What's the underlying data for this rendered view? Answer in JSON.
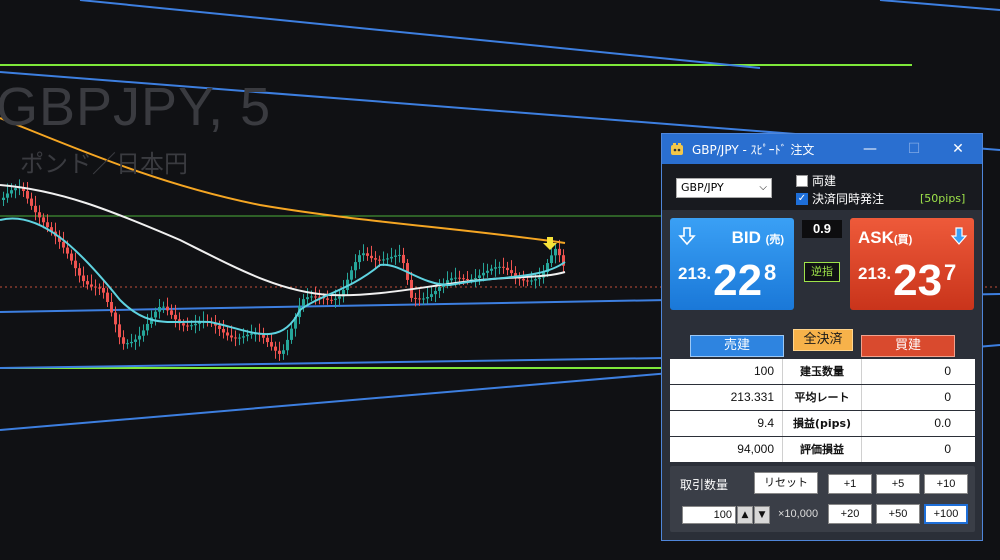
{
  "chart": {
    "symbol": "GBPJPY, 5",
    "name": "ポンド／日本円",
    "colors": {
      "background": "#101114",
      "bull": "#26a69a",
      "bear": "#ef5350",
      "ma_fast": "#5fd3e0",
      "ma_mid": "#f0f0f0",
      "ma_slow": "#f5a623",
      "trendline": "#3d7fe0",
      "level": "#7ee83a"
    }
  },
  "window": {
    "title": "GBP/JPY - ｽﾋﾟｰﾄﾞ 注文",
    "minimize": "—",
    "maximize": "☐",
    "close": "✕"
  },
  "order": {
    "pair": "GBP/JPY",
    "hedge_label": "両建",
    "hedge_checked": false,
    "oco_label": "決済同時発注",
    "oco_checked": true,
    "pips": "[50pips]",
    "bid": {
      "label": "BID",
      "sub": "(売)",
      "prefix": "213.",
      "big": "22",
      "pip": "8"
    },
    "ask": {
      "label": "ASK",
      "sub": "(買)",
      "prefix": "213.",
      "big": "23",
      "pip": "7"
    },
    "spread": "0.9",
    "stop_label": "逆指",
    "sell_tab": "売建",
    "buy_tab": "買建",
    "close_all": "全決済"
  },
  "positions": [
    {
      "sell": "100",
      "label": "建玉数量",
      "buy": "0"
    },
    {
      "sell": "213.331",
      "label": "平均レート",
      "buy": "0"
    },
    {
      "sell": "9.4",
      "label": "損益(pips)",
      "buy": "0.0"
    },
    {
      "sell": "94,000",
      "label": "評価損益",
      "buy": "0"
    }
  ],
  "quantity": {
    "label": "取引数量",
    "reset": "リセット",
    "value": "100",
    "unit": "×10,000",
    "up": "▲",
    "down": "▼",
    "increments": [
      "+1",
      "+5",
      "+10",
      "+20",
      "+50",
      "+100"
    ],
    "selected_increment": "+100"
  }
}
